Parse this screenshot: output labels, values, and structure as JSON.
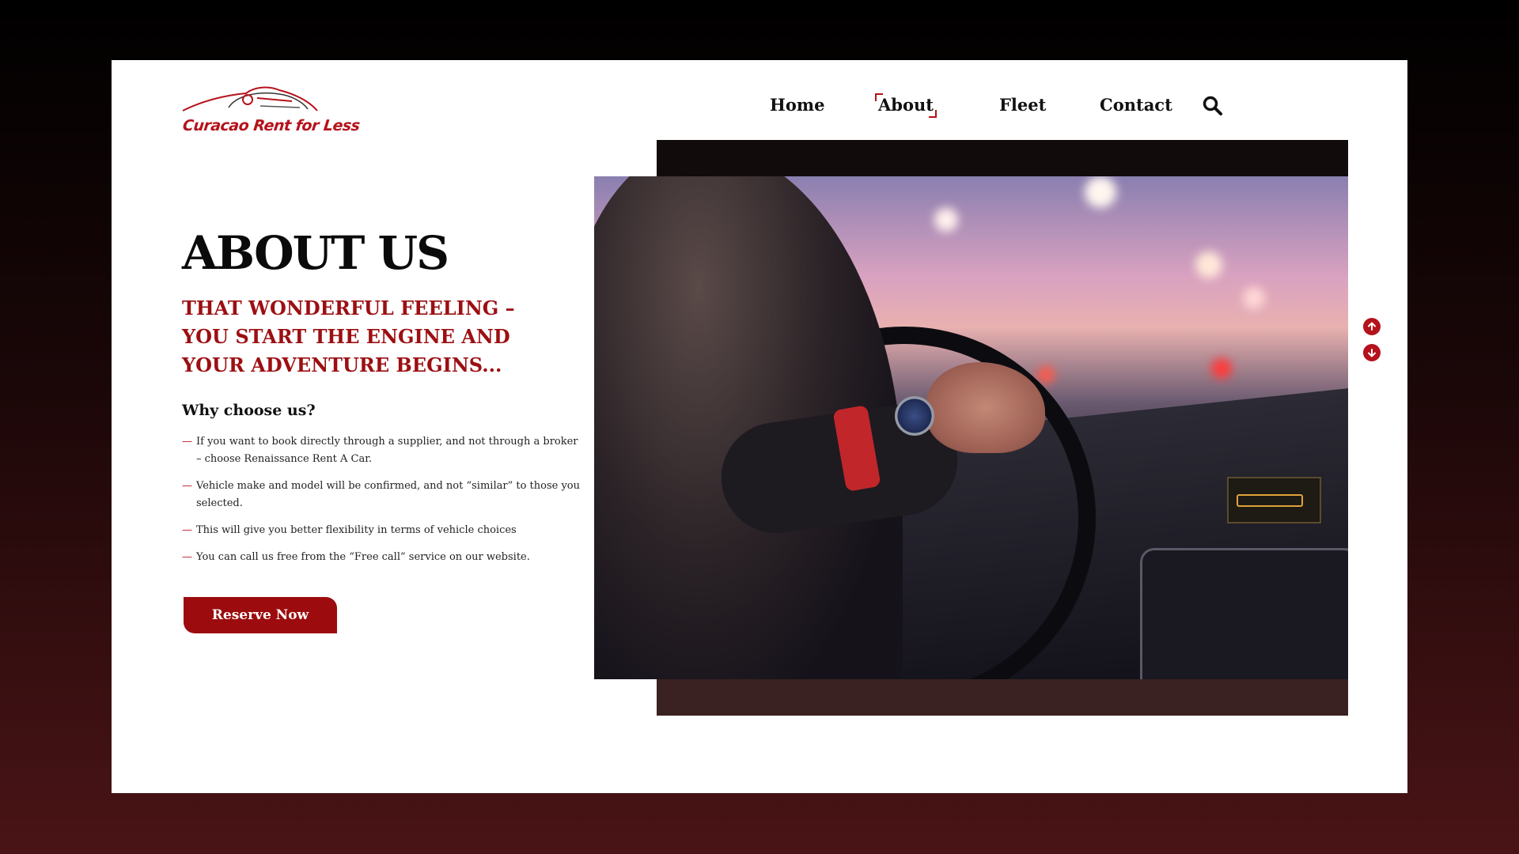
{
  "brand": {
    "name": "Curacao Rent for Less",
    "accent": "#b5121b",
    "accent_dark": "#9c0c0f"
  },
  "nav": {
    "items": [
      {
        "label": "Home",
        "active": false
      },
      {
        "label": "About",
        "active": true
      },
      {
        "label": "Fleet",
        "active": false
      },
      {
        "label": "Contact",
        "active": false
      }
    ],
    "search_icon": "search-icon"
  },
  "main": {
    "title": "ABOUT US",
    "subtitle": "THAT WONDERFUL FEELING – YOU START THE ENGINE AND YOUR ADVENTURE BEGINS...",
    "why_heading": "Why choose us?",
    "reasons": [
      "If you want to book directly through a supplier, and not through a broker – choose Renaissance Rent A Car.",
      "Vehicle make and model will be confirmed, and not “similar” to those you selected.",
      "This will give you better flexibility in terms of vehicle choices",
      "You can call us free from the “Free call” service on our website."
    ],
    "dash": "—",
    "reserve_label": "Reserve Now"
  },
  "media": {
    "image": "man-driving-car-photo"
  },
  "scroll": {
    "up_icon": "arrow-up-icon",
    "down_icon": "arrow-down-icon"
  }
}
